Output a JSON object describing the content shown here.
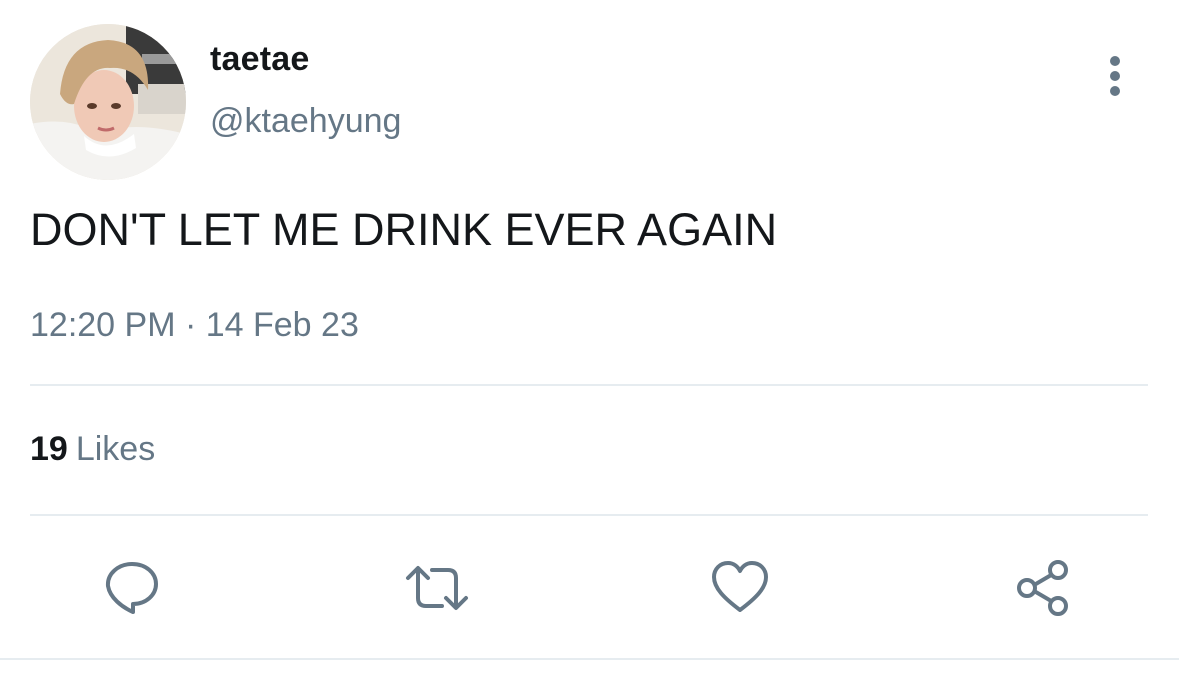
{
  "author": {
    "display_name": "taetae",
    "handle": "@ktaehyung"
  },
  "tweet": {
    "text": "DON'T LET ME DRINK EVER AGAIN",
    "timestamp": "12:20 PM · 14 Feb 23"
  },
  "stats": {
    "likes_count": "19",
    "likes_label": "Likes"
  },
  "actions": {
    "icons": [
      "reply-icon",
      "retweet-icon",
      "like-icon",
      "share-icon"
    ]
  },
  "colors": {
    "text_primary": "#14171a",
    "text_secondary": "#657786",
    "divider": "#e6ecf0",
    "background": "#ffffff"
  }
}
